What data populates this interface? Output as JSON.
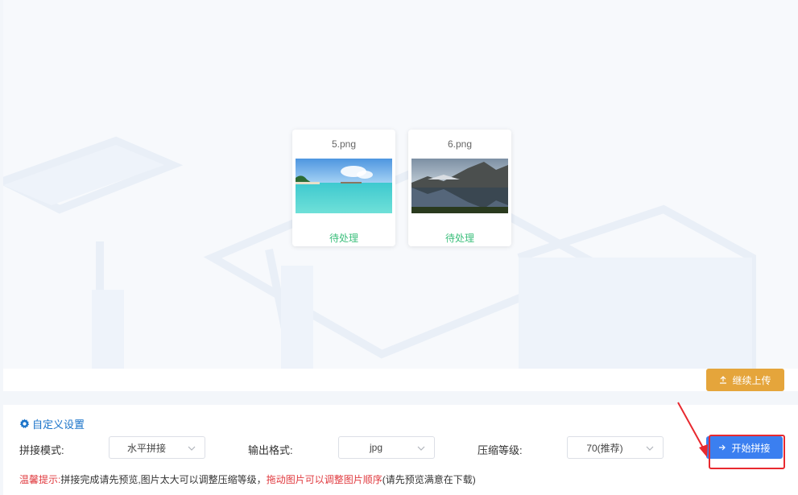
{
  "files": [
    {
      "name": "5.png",
      "status": "待处理"
    },
    {
      "name": "6.png",
      "status": "待处理"
    }
  ],
  "upload": {
    "continue_label": "继续上传"
  },
  "settings": {
    "title": "自定义设置",
    "mode_label": "拼接模式:",
    "mode_value": "水平拼接",
    "format_label": "输出格式:",
    "format_value": "jpg",
    "compress_label": "压缩等级:",
    "compress_value": "70(推荐)",
    "start_label": "开始拼接"
  },
  "tip": {
    "prefix": "温馨提示:",
    "part1": "拼接完成请先预览,图片太大可以调整压缩等级，",
    "part2": "拖动图片可以调整图片顺序",
    "part3": "(请先预览满意在下载)"
  },
  "colors": {
    "accent": "#3b7ff0",
    "warning_button": "#e5a53b",
    "status_green": "#3cbf7c",
    "annotation_red": "#e8292f"
  },
  "icons": {
    "settings": "gear-icon",
    "upload": "upload-icon",
    "start": "arrow-right-icon",
    "select": "chevron-down-icon"
  }
}
